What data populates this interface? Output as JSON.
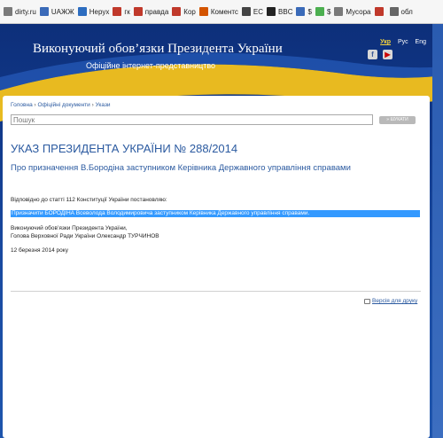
{
  "bookmarks": [
    {
      "label": "dirty.ru",
      "icon": "globe-icon",
      "color": "#7a7a7a"
    },
    {
      "label": "UAЖЖ",
      "icon": "pen-icon",
      "color": "#3a6ab8"
    },
    {
      "label": "Нерух",
      "icon": "building-icon",
      "color": "#2d6dc0"
    },
    {
      "label": "гк",
      "icon": "gk-icon",
      "color": "#c0392b"
    },
    {
      "label": "правда",
      "icon": "k-icon",
      "color": "#c0392b"
    },
    {
      "label": "Кор",
      "icon": "k-icon",
      "color": "#c0392b"
    },
    {
      "label": "Коментс",
      "icon": "k-icon",
      "color": "#d35400"
    },
    {
      "label": "EC",
      "icon": "grid-icon",
      "color": "#444"
    },
    {
      "label": "BBC",
      "icon": "bbc-icon",
      "color": "#222"
    },
    {
      "label": "$",
      "icon": "blue-square-icon",
      "color": "#3a6ab8"
    },
    {
      "label": "$",
      "icon": "circle-icon",
      "color": "#4caf50"
    },
    {
      "label": "Мусора",
      "icon": "globe-icon",
      "color": "#7a7a7a"
    },
    {
      "label": "",
      "icon": "app-icon",
      "color": "#c0392b"
    },
    {
      "label": "обл",
      "icon": "search-icon",
      "color": "#666"
    }
  ],
  "site": {
    "title": "Виконуючий обов’язки Президента України",
    "subtitle": "Офіційне інтернет-представництво",
    "languages": [
      "Укр",
      "Рус",
      "Eng"
    ],
    "active_language": "Укр"
  },
  "breadcrumb": {
    "home": "Головна",
    "docs": "Офіційні документи",
    "decrees": "Укази",
    "separator": "›"
  },
  "search": {
    "placeholder": "Пошук",
    "button": "» ШУКАТИ"
  },
  "decree": {
    "title": "УКАЗ ПРЕЗИДЕНТА УКРАЇНИ № 288/2014",
    "subtitle": "Про призначення В.Бородіна заступником Керівника Державного управління справами",
    "preamble": "Відповідно до статті 112 Конституції України постановляю:",
    "text": "Призначити БОРОДІНА Всеволода Володимировича заступником Керівника Державного управління справами.",
    "signer_line1": "Виконуючий обов’язки Президента України,",
    "signer_line2": "Голова Верховної Ради України Олександр ТУРЧИНОВ",
    "date": "12 березня 2014 року"
  },
  "print_label": "Версія для друку",
  "colors": {
    "link": "#2b5aa0",
    "highlight": "#3399ff",
    "header_blue": "#123b8d",
    "flag_yellow": "#f4c21a"
  }
}
